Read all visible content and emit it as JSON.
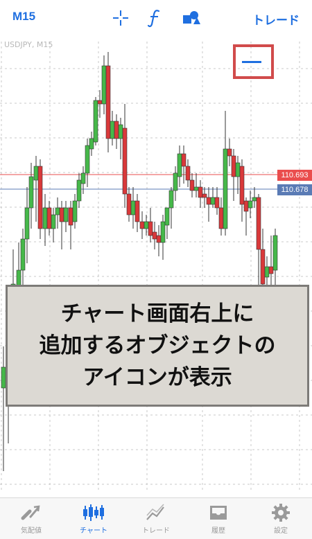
{
  "toolbar": {
    "timeframe": "M15",
    "trade_label": "トレード",
    "icons": [
      "crosshair-icon",
      "function-icon",
      "objects-icon"
    ]
  },
  "chart": {
    "symbol": "USDJPY, M15",
    "price_red": "110.693",
    "price_blue": "110.678",
    "colors": {
      "up": "#46b84a",
      "down": "#d9393a",
      "grid": "#c8c8c8",
      "highlight": "#d14b4b"
    }
  },
  "caption": {
    "line1": "チャート画面右上に",
    "line2": "追加するオブジェクトの",
    "line3": "アイコンが表示"
  },
  "tabs": [
    {
      "label": "気配値",
      "icon": "quotes-icon"
    },
    {
      "label": "チャート",
      "icon": "chart-icon",
      "active": true
    },
    {
      "label": "トレード",
      "icon": "trade-icon"
    },
    {
      "label": "履歴",
      "icon": "history-icon"
    },
    {
      "label": "設定",
      "icon": "settings-icon"
    }
  ]
}
